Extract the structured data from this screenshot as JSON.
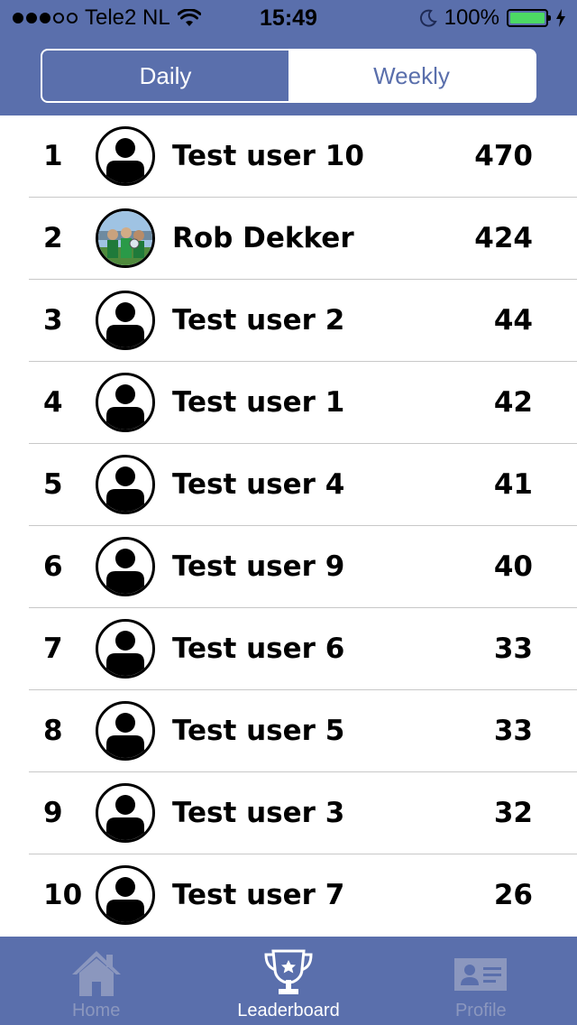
{
  "status": {
    "carrier": "Tele2 NL",
    "time": "15:49",
    "battery": "100%",
    "battery_level": 1.0,
    "signal_bars_filled": 3,
    "signal_bars_total": 5
  },
  "segment": {
    "daily_label": "Daily",
    "weekly_label": "Weekly",
    "selected": "Daily"
  },
  "leaderboard": [
    {
      "rank": "1",
      "name": "Test user 10",
      "score": "470",
      "avatar": "default-user-icon"
    },
    {
      "rank": "2",
      "name": "Rob Dekker",
      "score": "424",
      "avatar": "photo"
    },
    {
      "rank": "3",
      "name": "Test user 2",
      "score": "44",
      "avatar": "default-user-icon"
    },
    {
      "rank": "4",
      "name": "Test user 1",
      "score": "42",
      "avatar": "default-user-icon"
    },
    {
      "rank": "5",
      "name": "Test user 4",
      "score": "41",
      "avatar": "default-user-icon"
    },
    {
      "rank": "6",
      "name": "Test user 9",
      "score": "40",
      "avatar": "default-user-icon"
    },
    {
      "rank": "7",
      "name": "Test user 6",
      "score": "33",
      "avatar": "default-user-icon"
    },
    {
      "rank": "8",
      "name": "Test user 5",
      "score": "33",
      "avatar": "default-user-icon"
    },
    {
      "rank": "9",
      "name": "Test user 3",
      "score": "32",
      "avatar": "default-user-icon"
    },
    {
      "rank": "10",
      "name": "Test user 7",
      "score": "26",
      "avatar": "default-user-icon"
    }
  ],
  "tabs": {
    "home_label": "Home",
    "leaderboard_label": "Leaderboard",
    "profile_label": "Profile",
    "selected": "Leaderboard"
  },
  "colors": {
    "brand": "#5a6fac",
    "tab_inactive": "#8b97be",
    "battery_green": "#4cd964"
  }
}
